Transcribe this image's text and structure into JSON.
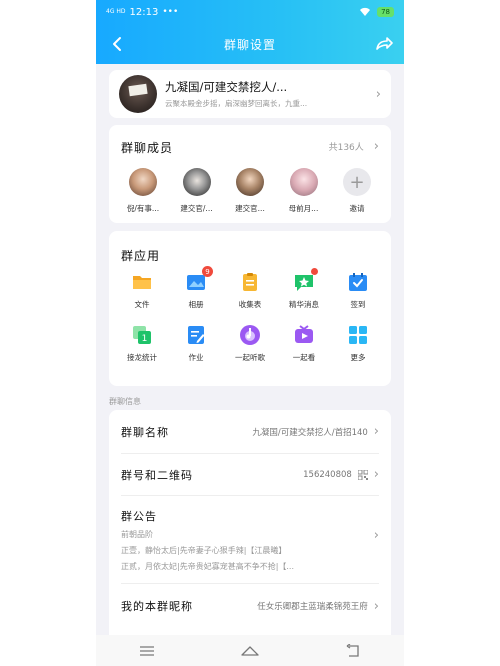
{
  "status": {
    "network": "4G HD",
    "time": "12:13",
    "extra": "•••",
    "battery": "78"
  },
  "header": {
    "title": "群聊设置"
  },
  "group": {
    "name": "九凝国/可建交禁挖人/...",
    "description": "云聚本殿金步摇，扇深幽梦回离长，九重..."
  },
  "members": {
    "title": "群聊成员",
    "count": "共136人",
    "items": [
      {
        "label": "倪/有事..."
      },
      {
        "label": "建交官/..."
      },
      {
        "label": "建交官..."
      },
      {
        "label": "母前月..."
      },
      {
        "label": "邀请"
      }
    ]
  },
  "apps": {
    "title": "群应用",
    "items": [
      {
        "label": "文件",
        "icon": "folder-icon"
      },
      {
        "label": "相册",
        "icon": "album-icon",
        "badge": "9"
      },
      {
        "label": "收集表",
        "icon": "form-icon"
      },
      {
        "label": "精华消息",
        "icon": "essence-icon"
      },
      {
        "label": "签到",
        "icon": "checkin-icon"
      },
      {
        "label": "接龙统计",
        "icon": "relay-icon"
      },
      {
        "label": "作业",
        "icon": "homework-icon"
      },
      {
        "label": "一起听歌",
        "icon": "music-icon"
      },
      {
        "label": "一起看",
        "icon": "watch-icon"
      },
      {
        "label": "更多",
        "icon": "more-icon"
      }
    ]
  },
  "info": {
    "section_label": "群聊信息",
    "name_label": "群聊名称",
    "name_value": "九凝国/可建交禁挖人/首招140",
    "number_label": "群号和二维码",
    "number_value": "156240808",
    "notice_label": "群公告",
    "notice_lines": [
      "前朝品阶",
      "正壹，静怡太后|先帝妻子心狠手辣|【江晨曦】",
      "正贰，月依太妃|先帝贵妃寡宠甚高不争不抢|【..."
    ],
    "nickname_label": "我的本群昵称",
    "nickname_value": "任女乐卿郡主蓝瑞柔锦苑王府"
  },
  "colors": {
    "header_gradient_start": "#17a9ff",
    "header_gradient_end": "#3ad0f0",
    "page_bg": "#f2f2f7",
    "badge": "#f04a3c"
  }
}
